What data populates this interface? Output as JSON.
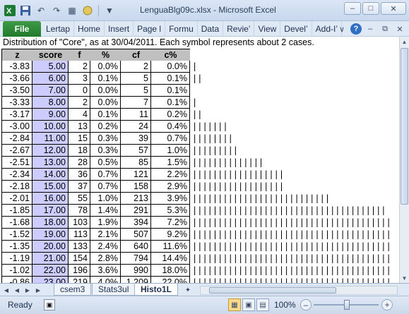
{
  "window": {
    "title": "LenguaBlg09c.xlsx - Microsoft Excel",
    "qat_icons": [
      "excel-logo-icon",
      "save-icon",
      "undo-icon",
      "redo-icon",
      "layout-icon",
      "circle-icon",
      "customize-icon"
    ],
    "controls": [
      "minimize",
      "maximize",
      "close"
    ]
  },
  "ribbon": {
    "file_tab": "File",
    "tabs": [
      "Lertap",
      "Home",
      "Insert",
      "Page l",
      "Formu",
      "Data",
      "Revie’",
      "View",
      "Devel’",
      "Add-I’"
    ]
  },
  "sheet": {
    "caption": "Distribution of \"Core\", as at 30/04/2011.  Each symbol represents about 2 cases.",
    "columns": [
      "z",
      "score",
      "f",
      "%",
      "cf",
      "c%"
    ],
    "rows": [
      {
        "z": "-3.83",
        "score": "5.00",
        "f": "2",
        "pct": "0.0%",
        "cf": "2",
        "cpct": "0.0%",
        "bars": "|"
      },
      {
        "z": "-3.66",
        "score": "6.00",
        "f": "3",
        "pct": "0.1%",
        "cf": "5",
        "cpct": "0.1%",
        "bars": "||"
      },
      {
        "z": "-3.50",
        "score": "7.00",
        "f": "0",
        "pct": "0.0%",
        "cf": "5",
        "cpct": "0.1%",
        "bars": ""
      },
      {
        "z": "-3.33",
        "score": "8.00",
        "f": "2",
        "pct": "0.0%",
        "cf": "7",
        "cpct": "0.1%",
        "bars": "|"
      },
      {
        "z": "-3.17",
        "score": "9.00",
        "f": "4",
        "pct": "0.1%",
        "cf": "11",
        "cpct": "0.2%",
        "bars": "||"
      },
      {
        "z": "-3.00",
        "score": "10.00",
        "f": "13",
        "pct": "0.2%",
        "cf": "24",
        "cpct": "0.4%",
        "bars": "|||||||"
      },
      {
        "z": "-2.84",
        "score": "11.00",
        "f": "15",
        "pct": "0.3%",
        "cf": "39",
        "cpct": "0.7%",
        "bars": "||||||||"
      },
      {
        "z": "-2.67",
        "score": "12.00",
        "f": "18",
        "pct": "0.3%",
        "cf": "57",
        "cpct": "1.0%",
        "bars": "|||||||||"
      },
      {
        "z": "-2.51",
        "score": "13.00",
        "f": "28",
        "pct": "0.5%",
        "cf": "85",
        "cpct": "1.5%",
        "bars": "||||||||||||||"
      },
      {
        "z": "-2.34",
        "score": "14.00",
        "f": "36",
        "pct": "0.7%",
        "cf": "121",
        "cpct": "2.2%",
        "bars": "||||||||||||||||||"
      },
      {
        "z": "-2.18",
        "score": "15.00",
        "f": "37",
        "pct": "0.7%",
        "cf": "158",
        "cpct": "2.9%",
        "bars": "||||||||||||||||||"
      },
      {
        "z": "-2.01",
        "score": "16.00",
        "f": "55",
        "pct": "1.0%",
        "cf": "213",
        "cpct": "3.9%",
        "bars": "|||||||||||||||||||||||||||"
      },
      {
        "z": "-1.85",
        "score": "17.00",
        "f": "78",
        "pct": "1.4%",
        "cf": "291",
        "cpct": "5.3%",
        "bars": "||||||||||||||||||||||||||||||||||||||"
      },
      {
        "z": "-1.68",
        "score": "18.00",
        "f": "103",
        "pct": "1.9%",
        "cf": "394",
        "cpct": "7.2%",
        "bars": "|||||||||||||||||||||||||||||||||||||||"
      },
      {
        "z": "-1.52",
        "score": "19.00",
        "f": "113",
        "pct": "2.1%",
        "cf": "507",
        "cpct": "9.2%",
        "bars": "|||||||||||||||||||||||||||||||||||||||"
      },
      {
        "z": "-1.35",
        "score": "20.00",
        "f": "133",
        "pct": "2.4%",
        "cf": "640",
        "cpct": "11.6%",
        "bars": "|||||||||||||||||||||||||||||||||||||||"
      },
      {
        "z": "-1.19",
        "score": "21.00",
        "f": "154",
        "pct": "2.8%",
        "cf": "794",
        "cpct": "14.4%",
        "bars": "|||||||||||||||||||||||||||||||||||||||"
      },
      {
        "z": "-1.02",
        "score": "22.00",
        "f": "196",
        "pct": "3.6%",
        "cf": "990",
        "cpct": "18.0%",
        "bars": "|||||||||||||||||||||||||||||||||||||||"
      },
      {
        "z": "-0.86",
        "score": "23.00",
        "f": "219",
        "pct": "4.0%",
        "cf": "1,209",
        "cpct": "22.0%",
        "bars": "|||||||||||||||||||||||||||||||||||||||"
      }
    ]
  },
  "sheet_tabs": {
    "tabs": [
      "csem3",
      "Stats3ul",
      "Histo1L"
    ],
    "active": "Histo1L"
  },
  "status": {
    "ready": "Ready",
    "zoom": "100%",
    "zoom_level_percent": 100
  }
}
